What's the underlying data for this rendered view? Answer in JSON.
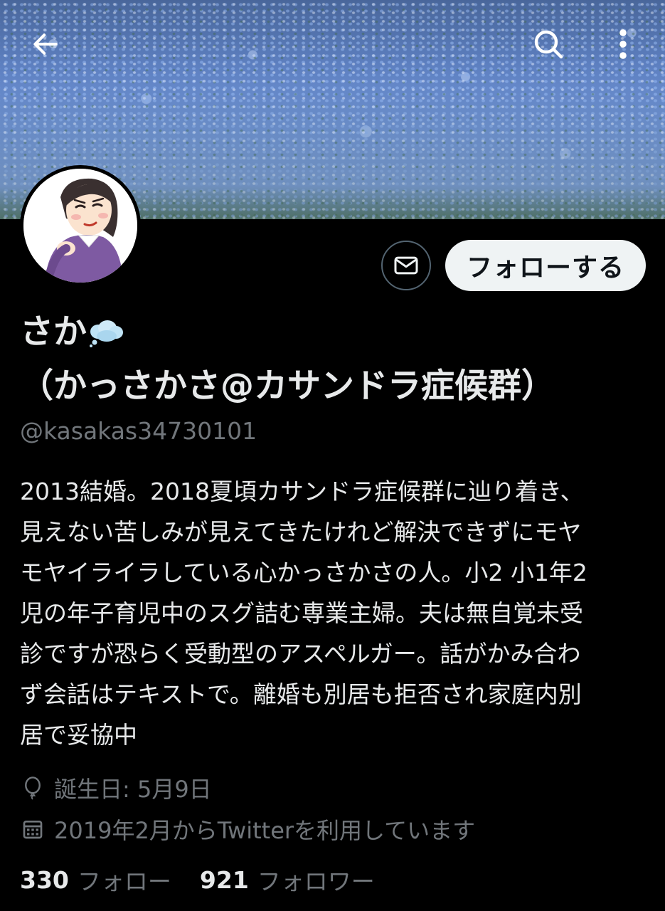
{
  "header": {
    "back_icon": "arrow-left-icon",
    "search_icon": "search-icon",
    "more_icon": "more-vertical-icon"
  },
  "profile": {
    "name_part1": "さか",
    "name_emoji": "thought-bubble-emoji",
    "name_part2": "（かっさかさ@カサンドラ症候群）",
    "handle": "@kasakas34730101",
    "bio": "2013結婚。2018夏頃カサンドラ症候群に辿り着き、\n見えない苦しみが見えてきたけれど解決できずにモヤ\nモヤイライラしている心かっさかさの人。小2 小1年2\n児の年子育児中のスグ詰む専業主婦。夫は無自覚未受\n診ですが恐らく受動型のアスペルガー。話がかみ合わ\nず会話はテキストで。離婚も別居も拒否され家庭内別\n居で妥協中",
    "birthday": "誕生日: 5月9日",
    "joined": "2019年2月からTwitterを利用しています"
  },
  "actions": {
    "message_icon": "envelope-icon",
    "follow_label": "フォローする"
  },
  "stats": {
    "following_count": "330",
    "following_label": "フォロー",
    "followers_count": "921",
    "followers_label": "フォロワー"
  },
  "colors": {
    "background": "#000000",
    "text_primary": "#e7e9ea",
    "text_secondary": "#71767b",
    "follow_button_bg": "#eff3f4",
    "border": "#536471"
  }
}
